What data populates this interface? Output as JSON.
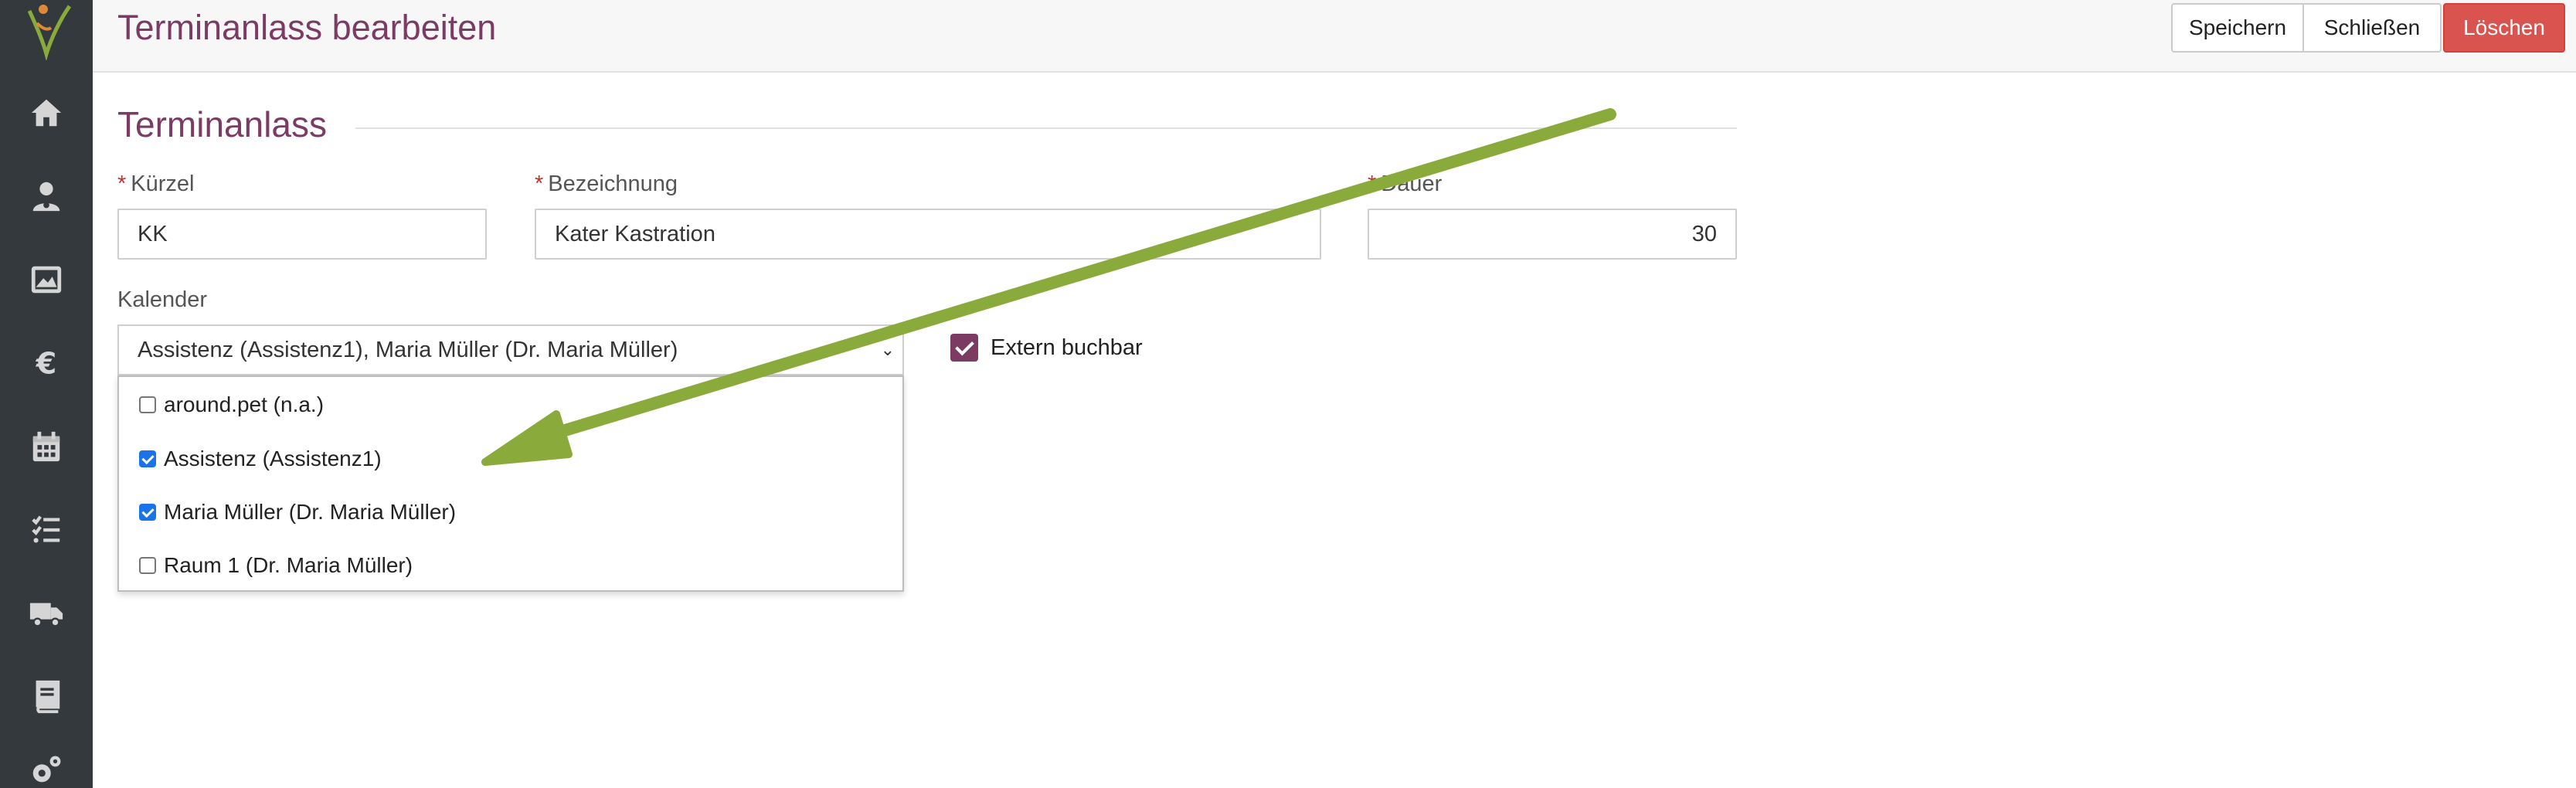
{
  "header": {
    "title": "Terminanlass bearbeiten",
    "buttons": {
      "save": "Speichern",
      "close": "Schließen",
      "delete": "Löschen"
    }
  },
  "sidebar": {
    "items": [
      {
        "icon": "home-icon"
      },
      {
        "icon": "patient-icon"
      },
      {
        "icon": "image-icon"
      },
      {
        "icon": "euro-icon"
      },
      {
        "icon": "calendar-icon"
      },
      {
        "icon": "tasks-icon"
      },
      {
        "icon": "truck-icon"
      },
      {
        "icon": "book-icon"
      },
      {
        "icon": "settings-icon"
      }
    ]
  },
  "form": {
    "section_title": "Terminanlass",
    "required_mark": "*",
    "kuerzel": {
      "label": "Kürzel",
      "value": "KK"
    },
    "bezeichnung": {
      "label": "Bezeichnung",
      "value": "Kater Kastration"
    },
    "dauer": {
      "label": "Dauer",
      "value": "30"
    },
    "kalender": {
      "label": "Kalender",
      "value": "Assistenz (Assistenz1), Maria Müller (Dr. Maria Müller)",
      "options": [
        {
          "label": "around.pet (n.a.)",
          "checked": false
        },
        {
          "label": "Assistenz (Assistenz1)",
          "checked": true
        },
        {
          "label": "Maria Müller (Dr. Maria Müller)",
          "checked": true
        },
        {
          "label": "Raum 1 (Dr. Maria Müller)",
          "checked": false
        }
      ]
    },
    "extern": {
      "label": "Extern buchbar",
      "checked": true
    }
  },
  "colors": {
    "sidebar": "#33393c",
    "accent": "#7b3b63",
    "danger": "#d9534f",
    "arrow": "#8aab3c"
  }
}
